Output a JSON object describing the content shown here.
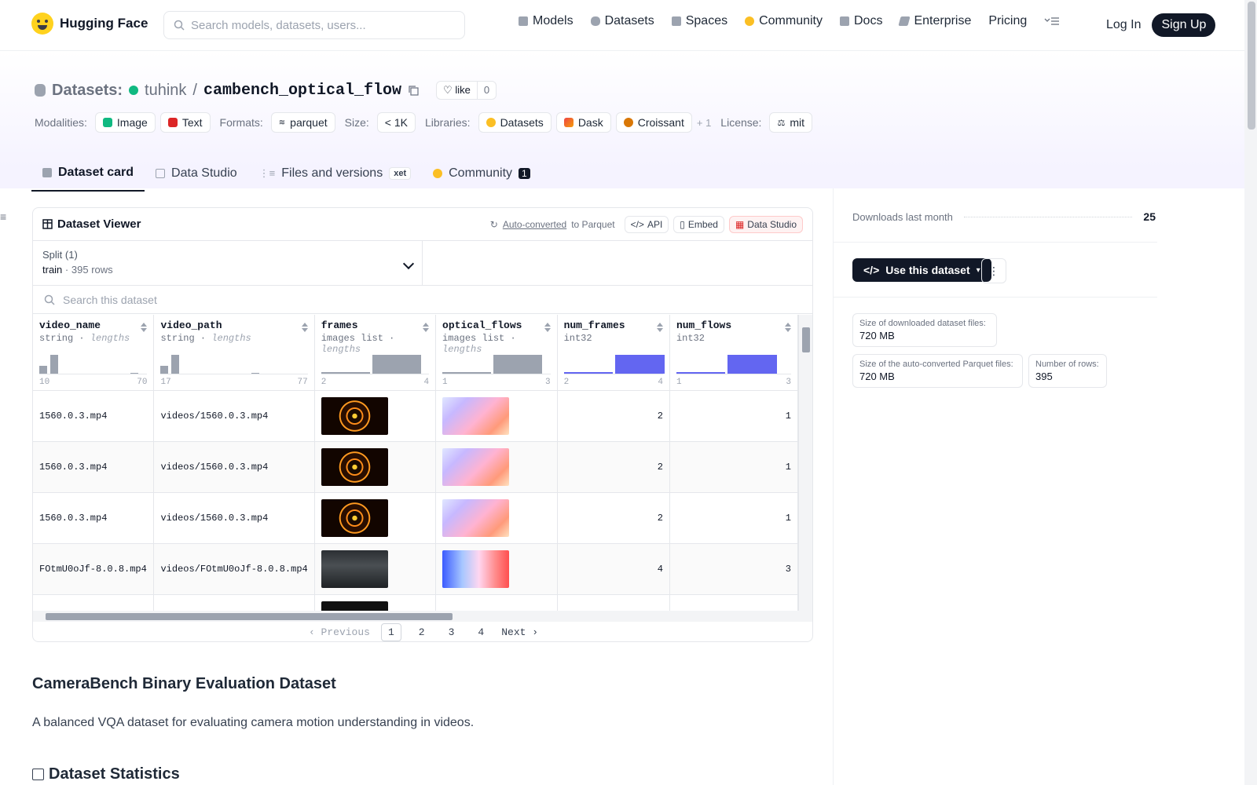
{
  "header": {
    "logo_text": "Hugging Face",
    "search_placeholder": "Search models, datasets, users...",
    "nav": [
      {
        "label": "Models",
        "icon": "cube-icon",
        "color": "#9ca3af"
      },
      {
        "label": "Datasets",
        "icon": "database-icon",
        "color": "#9ca3af"
      },
      {
        "label": "Spaces",
        "icon": "grid-icon",
        "color": "#9ca3af"
      },
      {
        "label": "Community",
        "icon": "community-icon",
        "color": "#fbbf24"
      },
      {
        "label": "Docs",
        "icon": "book-icon",
        "color": "#9ca3af"
      },
      {
        "label": "Enterprise",
        "icon": "enterprise-icon",
        "color": "#9ca3af"
      },
      {
        "label": "Pricing"
      }
    ],
    "login": "Log In",
    "signup": "Sign Up"
  },
  "repo": {
    "type_label": "Datasets:",
    "owner": "tuhink",
    "separator": "/",
    "name": "cambench_optical_flow",
    "like_label": "like",
    "like_count": "0",
    "meta": {
      "modalities_label": "Modalities:",
      "modalities": [
        "Image",
        "Text"
      ],
      "formats_label": "Formats:",
      "format": "parquet",
      "size_label": "Size:",
      "size": "< 1K",
      "libraries_label": "Libraries:",
      "libraries": [
        "Datasets",
        "Dask",
        "Croissant"
      ],
      "libraries_more": "+ 1",
      "license_label": "License:",
      "license": "mit"
    },
    "tabs": [
      {
        "label": "Dataset card",
        "active": true
      },
      {
        "label": "Data Studio"
      },
      {
        "label": "Files and versions",
        "badge": "xet"
      },
      {
        "label": "Community",
        "badge": "1"
      }
    ]
  },
  "viewer": {
    "title": "Dataset Viewer",
    "auto_converted": "Auto-converted",
    "to_parquet": "to Parquet",
    "api": "API",
    "embed": "Embed",
    "data_studio": "Data Studio",
    "split_label": "Split (1)",
    "split_name": "train",
    "split_rows": "395 rows",
    "search_placeholder": "Search this dataset",
    "columns": [
      {
        "name": "video_name",
        "type": "string",
        "extra": "lengths",
        "min": "10",
        "max": "70"
      },
      {
        "name": "video_path",
        "type": "string",
        "extra": "lengths",
        "min": "17",
        "max": "77"
      },
      {
        "name": "frames",
        "type": "images list",
        "extra": "lengths",
        "min": "2",
        "max": "4"
      },
      {
        "name": "optical_flows",
        "type": "images list",
        "extra": "lengths",
        "min": "1",
        "max": "3"
      },
      {
        "name": "num_frames",
        "type": "int32",
        "extra": "",
        "min": "2",
        "max": "4"
      },
      {
        "name": "num_flows",
        "type": "int32",
        "extra": "",
        "min": "1",
        "max": "3"
      }
    ],
    "rows": [
      {
        "video_name": "1560.0.3.mp4",
        "video_path": "videos/1560.0.3.mp4",
        "num_frames": "2",
        "num_flows": "1"
      },
      {
        "video_name": "1560.0.3.mp4",
        "video_path": "videos/1560.0.3.mp4",
        "num_frames": "2",
        "num_flows": "1"
      },
      {
        "video_name": "1560.0.3.mp4",
        "video_path": "videos/1560.0.3.mp4",
        "num_frames": "2",
        "num_flows": "1"
      },
      {
        "video_name": "FOtmU0oJf-8.0.8.mp4",
        "video_path": "videos/FOtmU0oJf-8.0.8.mp4",
        "num_frames": "4",
        "num_flows": "3"
      }
    ],
    "pager": {
      "prev": "Previous",
      "pages": [
        "1",
        "2",
        "3",
        "4"
      ],
      "next": "Next",
      "current": "1"
    }
  },
  "card": {
    "title": "CameraBench Binary Evaluation Dataset",
    "description": "A balanced VQA dataset for evaluating camera motion understanding in videos.",
    "stats_title": "Dataset Statistics"
  },
  "sidebar": {
    "downloads_label": "Downloads last month",
    "downloads_value": "25",
    "use_button": "Use this dataset",
    "downloaded_size_label": "Size of downloaded dataset files:",
    "downloaded_size": "720 MB",
    "parquet_size_label": "Size of the auto-converted Parquet files:",
    "parquet_size": "720 MB",
    "rows_label": "Number of rows:",
    "rows_value": "395"
  }
}
